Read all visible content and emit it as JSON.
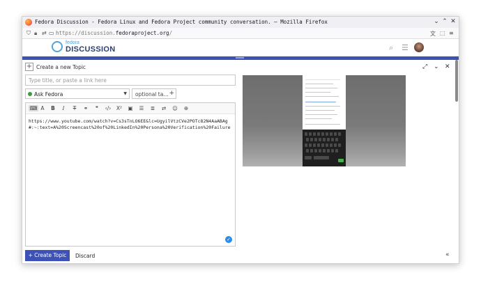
{
  "browser": {
    "window_title": "Fedora Discussion - Fedora Linux and Fedora Project community conversation. — Mozilla Firefox",
    "url_prefix": "https://discussion.",
    "url_domain": "fedoraproject.org",
    "url_suffix": "/"
  },
  "site": {
    "logo_small": "fedora",
    "logo_big": "DISCUSSION"
  },
  "composer": {
    "header_label": "Create a new Topic",
    "title_placeholder": "Type title, or paste a link here",
    "category": "Ask Fedora",
    "tags_placeholder": "optional ta…",
    "body_text": "https://www.youtube.com/watch?v=Cs3sTnLO6EE&lc=UgyilVtzCVe2POTc82N4AaABAg#:~:text=A%20Screencast%20of%20LinkedIn%20Persona%20Verification%20Failure",
    "create_button": "Create Topic",
    "discard": "Discard"
  },
  "colors": {
    "accent": "#3c52b8",
    "logo_blue": "#51a2da",
    "logo_navy": "#294172",
    "category_green": "#3c9b3f"
  }
}
